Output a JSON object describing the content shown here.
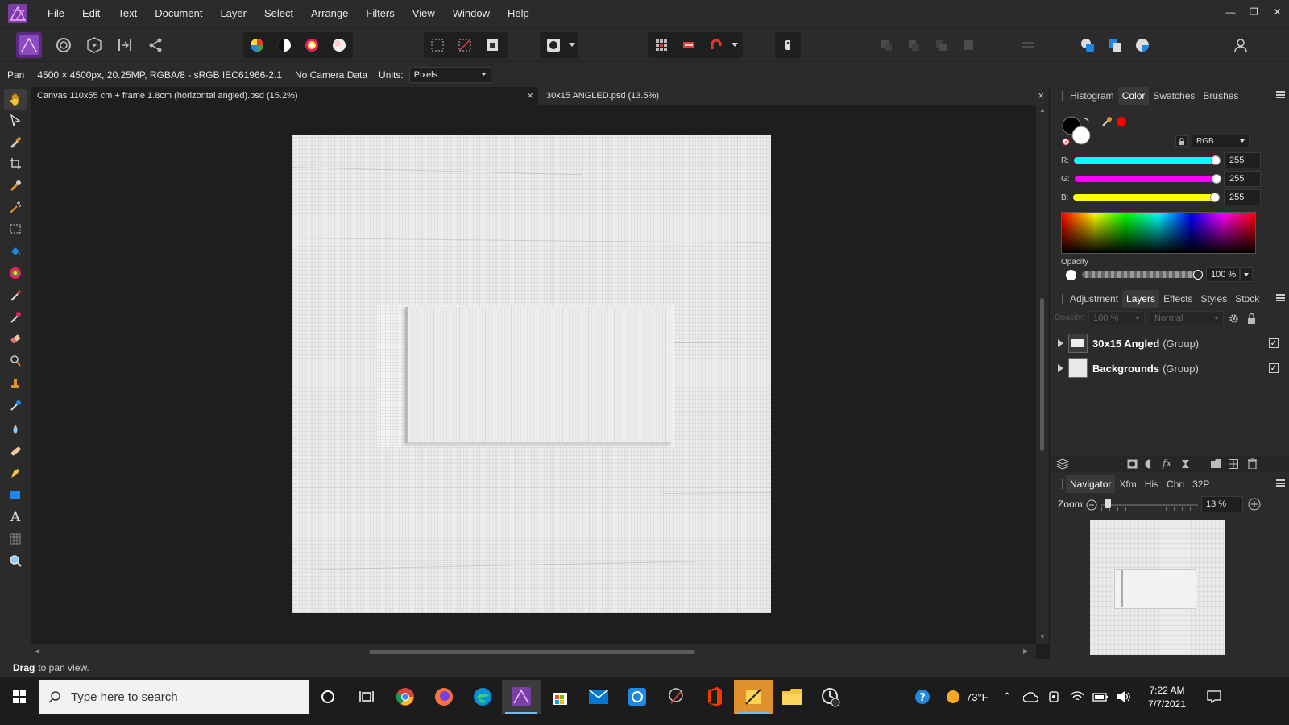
{
  "menu": [
    "File",
    "Edit",
    "Text",
    "Document",
    "Layer",
    "Select",
    "Arrange",
    "Filters",
    "View",
    "Window",
    "Help"
  ],
  "context": {
    "tool_name": "Pan",
    "doc_info": "4500 × 4500px, 20.25MP, RGBA/8 - sRGB IEC61966-2.1",
    "camera": "No Camera Data",
    "units_label": "Units:",
    "units_value": "Pixels"
  },
  "tabs": [
    {
      "label": "Canvas 110x55 cm + frame 1.8cm (horizontal angled).psd (15.2%)",
      "close": "×"
    },
    {
      "label": "30x15 ANGLED.psd (13.5%)",
      "close": "×"
    }
  ],
  "status": {
    "bold": "Drag",
    "text": "to pan view."
  },
  "color_panel": {
    "tabs": [
      "Histogram",
      "Color",
      "Swatches",
      "Brushes"
    ],
    "active_tab": "Color",
    "model": "RGB",
    "r_label": "R:",
    "g_label": "G:",
    "b_label": "B:",
    "r": "255",
    "g": "255",
    "b": "255",
    "opacity_label": "Opacity",
    "opacity": "100 %",
    "colors": {
      "primary": "#000000",
      "secondary": "#ffffff",
      "accent": "#ff0000"
    }
  },
  "layers_panel": {
    "tabs": [
      "Adjustment",
      "Layers",
      "Effects",
      "Styles",
      "Stock"
    ],
    "active_tab": "Layers",
    "opacity_label": "Opacity:",
    "opacity": "100 %",
    "blend": "Normal",
    "layers": [
      {
        "name": "30x15 Angled",
        "kind": "(Group)"
      },
      {
        "name": "Backgrounds",
        "kind": "(Group)"
      }
    ]
  },
  "navigator_panel": {
    "tabs": [
      "Navigator",
      "Xfm",
      "His",
      "Chn",
      "32P"
    ],
    "active_tab": "Navigator",
    "zoom_label": "Zoom:",
    "zoom": "13 %"
  },
  "taskbar": {
    "search_placeholder": "Type here to search",
    "weather": "73°F",
    "time": "7:22 AM",
    "date": "7/7/2021"
  }
}
